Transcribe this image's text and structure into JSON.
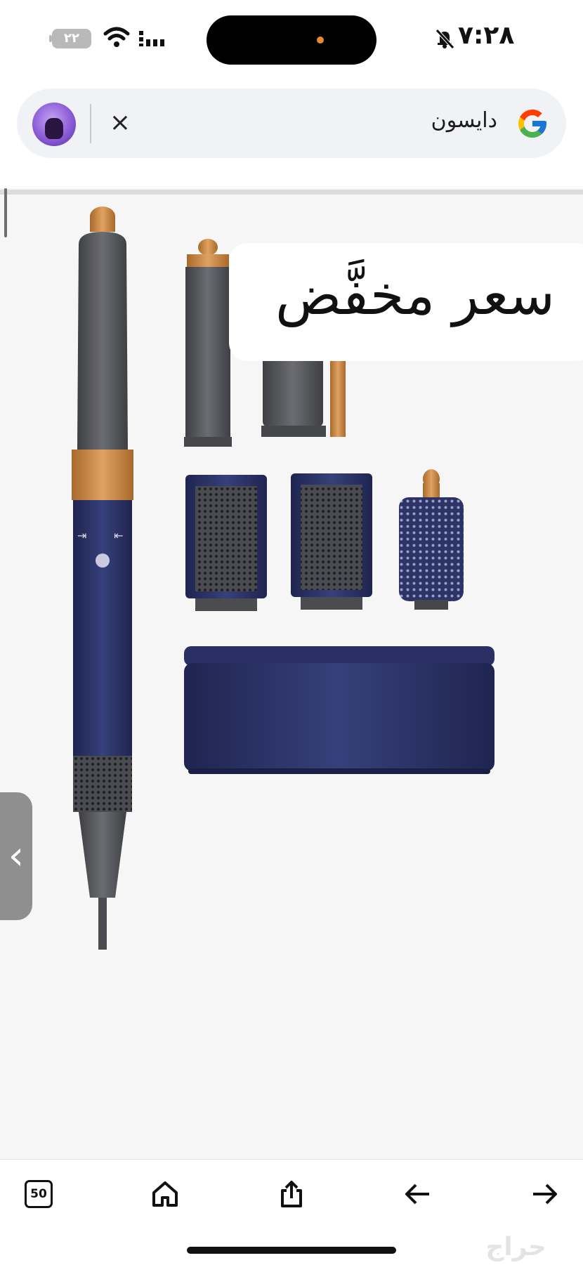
{
  "status_bar": {
    "time": "٧:٢٨",
    "battery": "٢٢",
    "icons": [
      "battery-icon",
      "wifi-icon",
      "cellular-signal-icon",
      "silent-mode-bell-icon"
    ]
  },
  "search_bar": {
    "query": "دايسون",
    "close_label": "×",
    "icons": [
      "google-logo-icon",
      "close-icon",
      "profile-avatar"
    ]
  },
  "product_overlay": {
    "price_text": "سعر مخفَّض"
  },
  "side_tab": {
    "label": "‹"
  },
  "bottom_nav": {
    "tabs_count": "50",
    "icons": [
      "tabs-icon",
      "home-icon",
      "share-icon",
      "back-arrow-icon",
      "forward-arrow-icon"
    ]
  },
  "watermark": "حراج",
  "colors": {
    "product_navy": "#2c3366",
    "product_copper": "#c8873f",
    "product_gunmetal": "#55565a",
    "search_bg": "#f0f2f5",
    "content_bg": "#f6f6f6"
  }
}
